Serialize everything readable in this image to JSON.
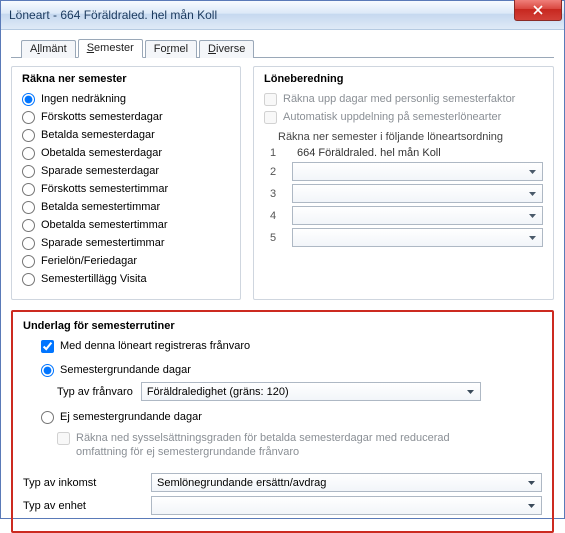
{
  "window": {
    "title": "Löneart - 664  Föräldraled. hel mån Koll"
  },
  "tabs": {
    "t1_pre": "A",
    "t1_u": "l",
    "t1_post": "lmänt",
    "t2_pre": "",
    "t2_u": "S",
    "t2_post": "emester",
    "t3_pre": "Fo",
    "t3_u": "r",
    "t3_post": "mel",
    "t4_pre": "",
    "t4_u": "D",
    "t4_post": "iverse"
  },
  "rakna": {
    "title": "Räkna ner semester",
    "r1": "Ingen nedräkning",
    "r2": "Förskotts semesterdagar",
    "r3": "Betalda semesterdagar",
    "r4": "Obetalda semesterdagar",
    "r5": "Sparade semesterdagar",
    "r6": "Förskotts semestertimmar",
    "r7": "Betalda semestertimmar",
    "r8": "Obetalda semestertimmar",
    "r9": "Sparade semestertimmar",
    "r10": "Ferielön/Feriedagar",
    "r11": "Semestertillägg Visita"
  },
  "lone": {
    "title": "Löneberedning",
    "c1": "Räkna upp dagar med personlig semesterfaktor",
    "c2": "Automatisk uppdelning på semesterlönearter",
    "hdr": "Räkna ner semester i följande löneartsordning",
    "rows": [
      {
        "n": "1",
        "text": "664 Föräldraled. hel mån Koll"
      },
      {
        "n": "2",
        "text": ""
      },
      {
        "n": "3",
        "text": ""
      },
      {
        "n": "4",
        "text": ""
      },
      {
        "n": "5",
        "text": ""
      }
    ]
  },
  "under": {
    "title": "Underlag för semesterrutiner",
    "chk": "Med denna löneart registreras frånvaro",
    "r1": "Semestergrundande dagar",
    "typ_franvaro_label": "Typ av frånvaro",
    "typ_franvaro_value": "Föräldraledighet (gräns: 120)",
    "r2": "Ej semestergrundande dagar",
    "chk2": "Räkna ned sysselsättningsgraden för betalda semesterdagar med reducerad omfattning för ej semestergrundande frånvaro",
    "inkomst_label": "Typ av inkomst",
    "inkomst_value": "Semlönegrundande ersättn/avdrag",
    "enhet_label": "Typ av enhet",
    "enhet_value": ""
  }
}
